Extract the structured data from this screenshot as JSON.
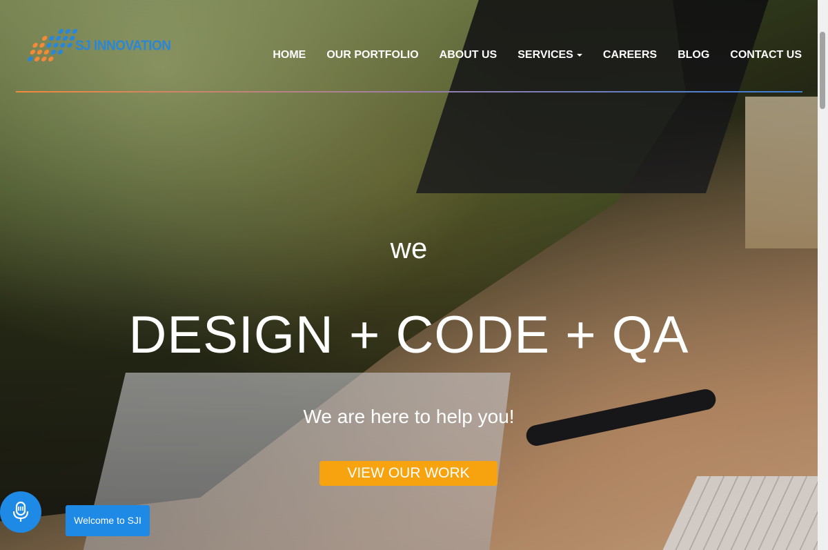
{
  "brand": {
    "name": "SJ INNOVATION",
    "logo_icon": "dot-grid-logo-icon",
    "logo_colors": [
      "#2a86d6",
      "#f28a3a"
    ]
  },
  "nav": {
    "items": [
      {
        "label": "HOME"
      },
      {
        "label": "OUR PORTFOLIO"
      },
      {
        "label": "ABOUT US"
      },
      {
        "label": "SERVICES",
        "has_dropdown": true
      },
      {
        "label": "CAREERS"
      },
      {
        "label": "BLOG"
      },
      {
        "label": "CONTACT US"
      }
    ]
  },
  "hero": {
    "small_text": "we",
    "headline": "DESIGN + CODE + QA",
    "subtext": "We are here to help you!",
    "cta_label": "VIEW OUR WORK",
    "cta_color": "#f7a30f"
  },
  "widgets": {
    "mic_icon": "microphone-icon",
    "chat_label": "Welcome to SJI",
    "accent": "#1f8ae6"
  }
}
